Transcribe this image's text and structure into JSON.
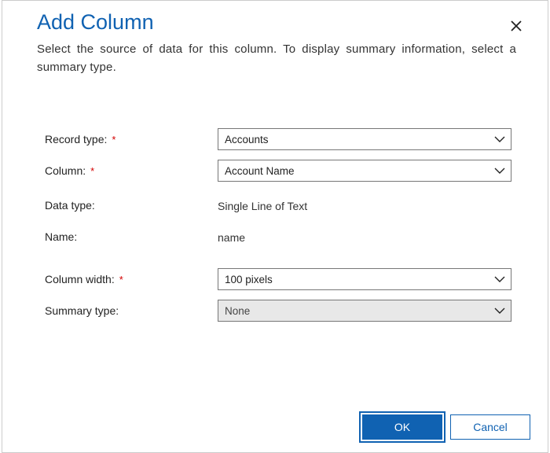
{
  "dialog": {
    "title": "Add Column",
    "subtitle": "Select the source of data for this column. To display summary information, select a summary type."
  },
  "form": {
    "record_type": {
      "label": "Record type:",
      "value": "Accounts",
      "required": true
    },
    "column": {
      "label": "Column:",
      "value": "Account Name",
      "required": true
    },
    "data_type": {
      "label": "Data type:",
      "value": "Single Line of Text"
    },
    "name": {
      "label": "Name:",
      "value": "name"
    },
    "column_width": {
      "label": "Column width:",
      "value": "100 pixels",
      "required": true
    },
    "summary_type": {
      "label": "Summary type:",
      "value": "None"
    }
  },
  "buttons": {
    "ok": "OK",
    "cancel": "Cancel"
  }
}
